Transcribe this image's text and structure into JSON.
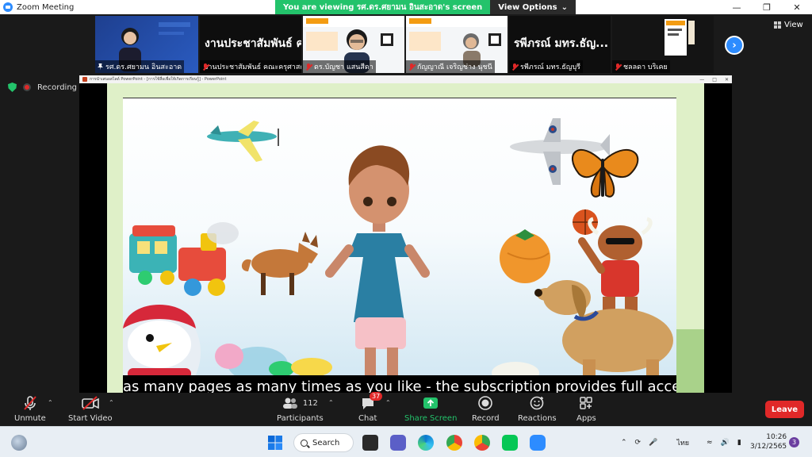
{
  "window": {
    "title": "Zoom Meeting"
  },
  "share_banner": {
    "viewing_prefix": "You are viewing ",
    "viewing_name": "รศ.ดร.ศยามน อินสะอาด",
    "viewing_suffix": "'s screen",
    "options_label": "View Options"
  },
  "gallery": {
    "tiles": [
      {
        "name": "รศ.ดร.ศยามน อินสะอาด",
        "big_name": ""
      },
      {
        "name": "งานประชาสัมพันธ์ คณะครุศาสตร์",
        "big_name": "งานประชาสัมพันธ์ ค..."
      },
      {
        "name": "ดร.บัญชา แสนสีดา",
        "big_name": ""
      },
      {
        "name": "กัญญาณี เจริญช่าง นุชนี",
        "big_name": ""
      },
      {
        "name": "รพีภรณ์ มทร.ธัญบุรี",
        "big_name": "รพีภรณ์ มทร.ธัญ..."
      },
      {
        "name": "ชลลดา บริเคย",
        "big_name": ""
      }
    ],
    "view_label": "View"
  },
  "recording": {
    "label": "Recording"
  },
  "shared_screen": {
    "app_title": "การนำเสนอสไลด์ PowerPoint - [การใช้สื่อเพื่อให้เกิดการเรียนรู้] - PowerPoint",
    "subtitle": "as many pages as many times as you like - the subscription provides full access!"
  },
  "toolbar": {
    "unmute_label": "Unmute",
    "start_video_label": "Start Video",
    "participants_count": "112",
    "participants_label": "Participants",
    "chat_badge": "37",
    "chat_label": "Chat",
    "share_label": "Share Screen",
    "record_label": "Record",
    "reactions_label": "Reactions",
    "apps_label": "Apps",
    "leave_label": "Leave"
  },
  "taskbar": {
    "search_label": "Search",
    "language": "ไทย",
    "time": "10:26",
    "date": "3/12/2565",
    "notifications": "3"
  },
  "colors": {
    "accent_green": "#23c36b",
    "zoom_blue": "#2d8cff",
    "leave_red": "#e02828"
  }
}
